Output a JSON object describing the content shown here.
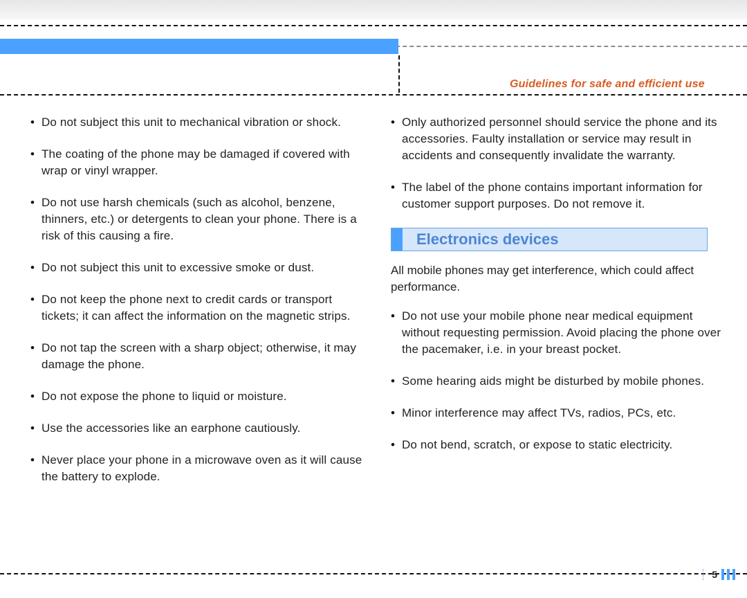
{
  "doc": {
    "header_title": "Guidelines for safe and efficient use",
    "section_title": "Electronics devices",
    "footer": {
      "page_number": "5"
    }
  },
  "left_column": [
    "Do not subject this unit to mechanical vibration or shock.",
    "The coating of the phone may be damaged if covered with wrap or vinyl wrapper.",
    "Do not use harsh chemicals (such as alcohol, benzene, thinners, etc.) or detergents to clean your phone. There is a risk of this causing a fire.",
    "Do not subject this unit to excessive smoke or dust.",
    "Do not keep the phone next to credit cards or transport tickets; it can affect the information on the magnetic strips.",
    "Do not tap the screen with a sharp object; otherwise, it may damage the phone.",
    "Do not expose the phone to liquid or moisture.",
    "Use the accessories like an earphone cautiously.",
    "Never place your phone in a microwave oven as it will cause the battery to explode."
  ],
  "right_column_pre": [
    "Only authorized personnel should service the phone and its accessories. Faulty installation or service may result in accidents and consequently invalidate the warranty.",
    "The label of the phone contains important information for customer support purposes. Do not remove it."
  ],
  "right_column_intro": "All mobile phones may get interference, which could affect performance.",
  "right_column_post": [
    "Do not use your mobile phone near medical equipment without requesting permission. Avoid placing the phone over the pacemaker, i.e. in your breast pocket.",
    "Some hearing aids might be disturbed by mobile phones.",
    "Minor interference may affect TVs, radios, PCs, etc.",
    "Do not bend, scratch, or expose to static electricity."
  ]
}
